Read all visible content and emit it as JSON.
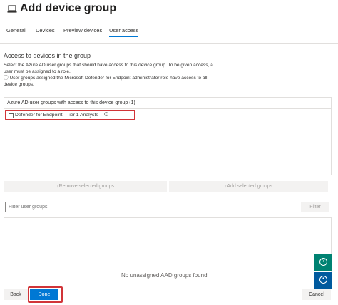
{
  "header": {
    "title": "Add device group",
    "icon": "laptop-icon"
  },
  "tabs": [
    {
      "label": "General",
      "active": false
    },
    {
      "label": "Devices",
      "active": false
    },
    {
      "label": "Preview devices",
      "active": false
    },
    {
      "label": "User access",
      "active": true
    }
  ],
  "access": {
    "section_title": "Access to devices in the group",
    "description_line1": "Select the Azure AD user groups that should have access to this device group. To be given access, a user must be assigned to a role.",
    "description_line2": "User groups assigned the Microsoft Defender for Endpoint administrator role have access to all device groups."
  },
  "assigned": {
    "header": "Azure AD user groups with access to this device group (1)",
    "items": [
      {
        "name": "Defender for Endpoint - Tier 1 Analysts",
        "checked": false
      }
    ]
  },
  "actions": {
    "remove_label": "↓Remove selected groups",
    "add_label": "↑Add selected groups"
  },
  "filter": {
    "placeholder": "Filter user groups",
    "button_label": "Filter"
  },
  "unassigned": {
    "empty_text": "No unassigned AAD groups found"
  },
  "footer": {
    "back_label": "Back",
    "done_label": "Done",
    "cancel_label": "Cancel"
  },
  "colors": {
    "accent": "#0078d4",
    "highlight": "#d13438",
    "help_button": "#008272"
  }
}
